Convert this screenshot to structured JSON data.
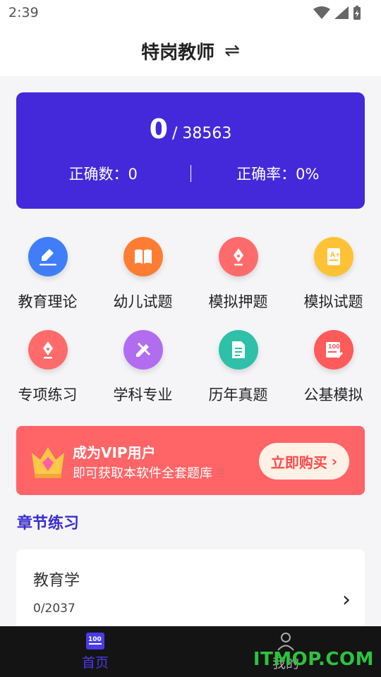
{
  "status_bar": {
    "time": "2:39"
  },
  "header": {
    "title": "特岗教师",
    "swap_glyph": "⇌"
  },
  "stats": {
    "done": "0",
    "total": "/ 38563",
    "correct_count": "正确数：0",
    "correct_rate": "正确率：0%"
  },
  "grid": [
    {
      "label": "教育理论",
      "icon": "pen-note-icon",
      "color": "#3f7ef8"
    },
    {
      "label": "幼儿试题",
      "icon": "book-icon",
      "color": "#ff7d33"
    },
    {
      "label": "模拟押题",
      "icon": "pen-nib-icon",
      "color": "#ff6b6b"
    },
    {
      "label": "模拟试题",
      "icon": "grade-paper-icon",
      "color": "#ffc234"
    },
    {
      "label": "专项练习",
      "icon": "pen-nib-icon",
      "color": "#ff6b6b"
    },
    {
      "label": "学科专业",
      "icon": "pencil-ruler-icon",
      "color": "#b16cf0"
    },
    {
      "label": "历年真题",
      "icon": "document-icon",
      "color": "#2ec0a9"
    },
    {
      "label": "公基模拟",
      "icon": "score-sheet-icon",
      "color": "#ff5b5b"
    }
  ],
  "vip": {
    "title": "成为VIP用户",
    "subtitle": "即可获取本软件全套题库",
    "button": "立即购买",
    "colors": {
      "bg": "#ff6467",
      "button_bg": "#fff1e6",
      "button_text": "#ff4a4a"
    }
  },
  "section": {
    "title": "章节练习"
  },
  "chapter": {
    "name": "教育学",
    "progress": "0/2037"
  },
  "tabbar": {
    "tabs": [
      {
        "label": "首页",
        "icon": "home-100-icon",
        "active": true
      },
      {
        "label": "我的",
        "icon": "person-icon",
        "active": false
      }
    ],
    "accent": "#4a3be8"
  },
  "watermark": "ITMOP.COM"
}
